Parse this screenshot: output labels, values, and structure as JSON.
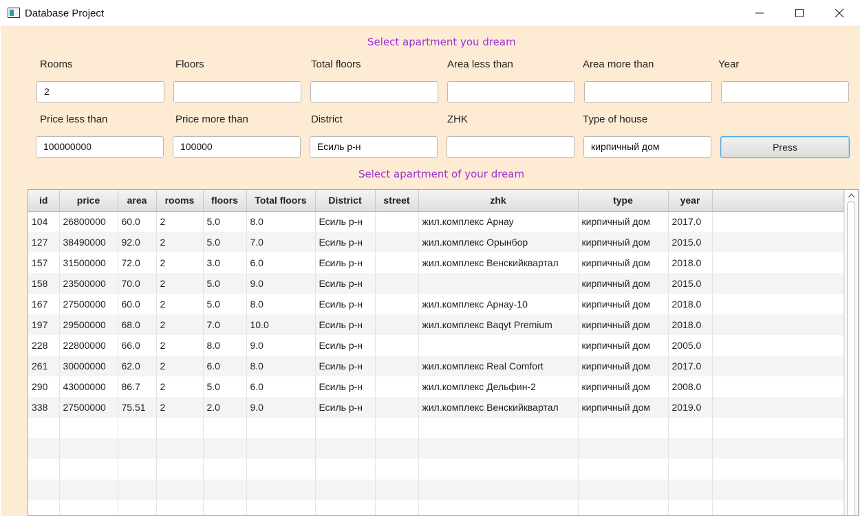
{
  "window": {
    "title": "Database Project"
  },
  "headings": {
    "top": "Select apartment you dream",
    "table": "Select apartment of your dream"
  },
  "filters": {
    "row1": [
      {
        "label": "Rooms",
        "value": "2"
      },
      {
        "label": "Floors",
        "value": ""
      },
      {
        "label": "Total floors",
        "value": ""
      },
      {
        "label": "Area less than",
        "value": ""
      },
      {
        "label": "Area more than",
        "value": ""
      },
      {
        "label": "Year",
        "value": ""
      }
    ],
    "row2": [
      {
        "label": "Price less than",
        "value": "100000000"
      },
      {
        "label": "Price more than",
        "value": "100000"
      },
      {
        "label": "District",
        "value": "Есиль р-н"
      },
      {
        "label": "ZHK",
        "value": ""
      },
      {
        "label": "Type of house",
        "value": "кирпичный дом"
      }
    ],
    "press_label": "Press"
  },
  "table": {
    "columns": [
      "id",
      "price",
      "area",
      "rooms",
      "floors",
      "Total floors",
      "District",
      "street",
      "zhk",
      "type",
      "year"
    ],
    "rows": [
      [
        "104",
        "26800000",
        "60.0",
        "2",
        "5.0",
        "8.0",
        "Есиль р-н",
        "",
        "жил.комплекс Арнау",
        "кирпичный дом",
        "2017.0"
      ],
      [
        "127",
        "38490000",
        "92.0",
        "2",
        "5.0",
        "7.0",
        "Есиль р-н",
        "",
        "жил.комплекс Орынбор",
        "кирпичный дом",
        "2015.0"
      ],
      [
        "157",
        "31500000",
        "72.0",
        "2",
        "3.0",
        "6.0",
        "Есиль р-н",
        "",
        "жил.комплекс Венскийквартал",
        "кирпичный дом",
        "2018.0"
      ],
      [
        "158",
        "23500000",
        "70.0",
        "2",
        "5.0",
        "9.0",
        "Есиль р-н",
        "",
        "",
        "кирпичный дом",
        "2015.0"
      ],
      [
        "167",
        "27500000",
        "60.0",
        "2",
        "5.0",
        "8.0",
        "Есиль р-н",
        "",
        "жил.комплекс Арнау-10",
        "кирпичный дом",
        "2018.0"
      ],
      [
        "197",
        "29500000",
        "68.0",
        "2",
        "7.0",
        "10.0",
        "Есиль р-н",
        "",
        "жил.комплекс Baqyt Premium",
        "кирпичный дом",
        "2018.0"
      ],
      [
        "228",
        "22800000",
        "66.0",
        "2",
        "8.0",
        "9.0",
        "Есиль р-н",
        "",
        "",
        "кирпичный дом",
        "2005.0"
      ],
      [
        "261",
        "30000000",
        "62.0",
        "2",
        "6.0",
        "8.0",
        "Есиль р-н",
        "",
        "жил.комплекс Real Comfort",
        "кирпичный дом",
        "2017.0"
      ],
      [
        "290",
        "43000000",
        "86.7",
        "2",
        "5.0",
        "6.0",
        "Есиль р-н",
        "",
        "жил.комплекс Дельфин-2",
        "кирпичный дом",
        "2008.0"
      ],
      [
        "338",
        "27500000",
        "75.51",
        "2",
        "2.0",
        "9.0",
        "Есиль р-н",
        "",
        "жил.комплекс Венскийквартал",
        "кирпичный дом",
        "2019.0"
      ]
    ]
  },
  "colors": {
    "background": "#fdebd3",
    "heading": "#9b30d9",
    "button_border": "#4aa6e8"
  }
}
